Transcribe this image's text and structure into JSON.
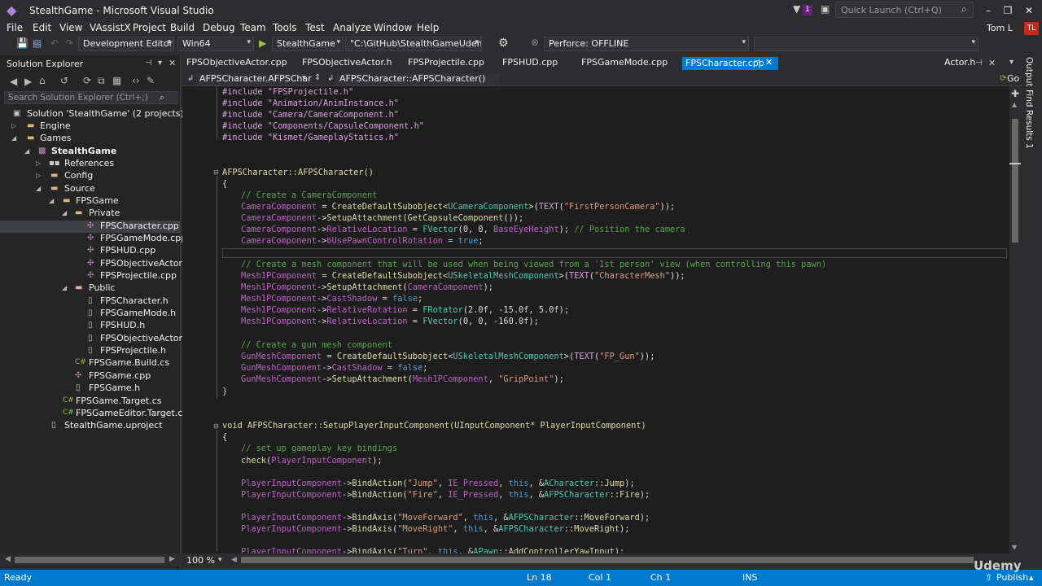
{
  "window": {
    "title": "StealthGame - Microsoft Visual Studio",
    "quick_launch": "Quick Launch (Ctrl+Q)",
    "notifications": "1",
    "user": "Tom L",
    "avatar": "TL"
  },
  "menu": [
    "File",
    "Edit",
    "View",
    "VAssistX",
    "Project",
    "Build",
    "Debug",
    "Team",
    "Tools",
    "Test",
    "Analyze",
    "Window",
    "Help"
  ],
  "toolbar": {
    "config": "Development Editor",
    "platform": "Win64",
    "project": "StealthGame",
    "path": "\"C:\\GitHub\\StealthGameUdemy\\St",
    "perforce": "Perforce: OFFLINE"
  },
  "solution_explorer": {
    "title": "Solution Explorer",
    "search_placeholder": "Search Solution Explorer (Ctrl+;)",
    "items": [
      {
        "label": "Solution 'StealthGame' (2 projects)",
        "icon": "solution-icon"
      },
      {
        "label": "Engine",
        "icon": "folder-icon"
      },
      {
        "label": "Games",
        "icon": "folder-icon"
      },
      {
        "label": "StealthGame",
        "icon": "project-icon"
      },
      {
        "label": "References",
        "icon": "references-icon"
      },
      {
        "label": "Config",
        "icon": "folder-icon"
      },
      {
        "label": "Source",
        "icon": "folder-icon"
      },
      {
        "label": "FPSGame",
        "icon": "folder-icon"
      },
      {
        "label": "Private",
        "icon": "folder-icon"
      },
      {
        "label": "FPSCharacter.cpp",
        "icon": "cpp-file-icon"
      },
      {
        "label": "FPSGameMode.cpp",
        "icon": "cpp-file-icon"
      },
      {
        "label": "FPSHUD.cpp",
        "icon": "cpp-file-icon"
      },
      {
        "label": "FPSObjectiveActor.cpp",
        "icon": "cpp-file-icon"
      },
      {
        "label": "FPSProjectile.cpp",
        "icon": "cpp-file-icon"
      },
      {
        "label": "Public",
        "icon": "folder-icon"
      },
      {
        "label": "FPSCharacter.h",
        "icon": "header-file-icon"
      },
      {
        "label": "FPSGameMode.h",
        "icon": "header-file-icon"
      },
      {
        "label": "FPSHUD.h",
        "icon": "header-file-icon"
      },
      {
        "label": "FPSObjectiveActor.h",
        "icon": "header-file-icon"
      },
      {
        "label": "FPSProjectile.h",
        "icon": "header-file-icon"
      },
      {
        "label": "FPSGame.Build.cs",
        "icon": "csharp-file-icon"
      },
      {
        "label": "FPSGame.cpp",
        "icon": "cpp-file-icon"
      },
      {
        "label": "FPSGame.h",
        "icon": "header-file-icon"
      },
      {
        "label": "FPSGame.Target.cs",
        "icon": "csharp-file-icon"
      },
      {
        "label": "FPSGameEditor.Target.cs",
        "icon": "csharp-file-icon"
      },
      {
        "label": "StealthGame.uproject",
        "icon": "file-icon"
      }
    ]
  },
  "tabs": [
    "FPSObjectiveActor.cpp",
    "FPSObjectiveActor.h",
    "FPSProjectile.cpp",
    "FPSHUD.cpp",
    "FPSGameMode.cpp",
    "FPSCharacter.cpp",
    "Actor.h"
  ],
  "nav": {
    "scope": "AFPSCharacter.AFPSCharact",
    "member": "AFPSCharacter::AFPSCharacter()",
    "go": "Go"
  },
  "code": {
    "l1": "#include \"FPSProjectile.h\"",
    "l2": "#include \"Animation/AnimInstance.h\"",
    "l3": "#include \"Camera/CameraComponent.h\"",
    "l4": "#include \"Components/CapsuleComponent.h\"",
    "l5": "#include \"Kismet/GameplayStatics.h\"",
    "ctor": "AFPSCharacter::AFPSCharacter()",
    "c1": "// Create a CameraComponent",
    "c2": "// Create a mesh component that will be used when being viewed from a '1st person' view (when controlling this pawn)",
    "c3": "// Create a gun mesh component",
    "c4": "// Position the camera",
    "c5": "// set up gameplay key bindings",
    "setup": "void AFPSCharacter::SetupPlayerInputComponent(UInputComponent* PlayerInputComponent)"
  },
  "zoom": "100 %",
  "side_tabs": {
    "output": "Output",
    "find": "Find Results 1"
  },
  "status": {
    "ready": "Ready",
    "ln": "Ln 18",
    "col": "Col 1",
    "ch": "Ch 1",
    "ins": "INS",
    "publish": "Publish"
  },
  "watermark": "Udemy"
}
